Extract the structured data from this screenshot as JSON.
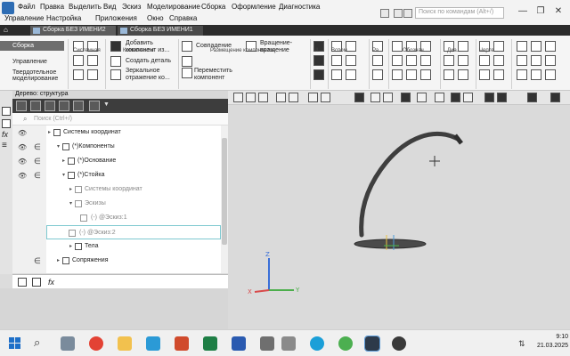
{
  "menu": {
    "items": [
      "Файл",
      "Правка",
      "Выделить",
      "Вид",
      "Эскиз",
      "Моделирование",
      "Сборка",
      "Оформление",
      "Диагностика"
    ],
    "items2": [
      "Управление",
      "Настройка",
      "Приложения",
      "Окно",
      "Справка"
    ],
    "search_placeholder": "Поиск по командам (Alt+/)"
  },
  "doc_tabs": [
    "Сборка БЕЗ ИМЕНИ2",
    "Сборка БЕЗ ИМЕНИ1"
  ],
  "left_tabs": [
    "Сборка",
    "Управление",
    "Твердотельное",
    "моделирование"
  ],
  "ribbon": {
    "add_component_1": "Добавить",
    "add_component_2": "компонент из...",
    "create_part": "Создать деталь",
    "mirror_1": "Зеркальное",
    "mirror_2": "отражение ко...",
    "match": "Совпадение",
    "rotate_1": "Вращение-",
    "rotate_2": "вращение",
    "move_1": "Переместить",
    "move_2": "компонент",
    "groups": [
      "Системная",
      "Компоненты",
      "Размещение компонентов",
      "М...",
      "Вспом...",
      "Ра...",
      "Обознач...",
      "Диа...",
      "Черте..."
    ]
  },
  "tree": {
    "header": "Дерево: структура",
    "search_placeholder": "Поиск (Ctrl+/)",
    "rows": [
      {
        "label": "Системы координат",
        "grey": false
      },
      {
        "label": "(*)Компоненты",
        "grey": false
      },
      {
        "label": "(*)Основание",
        "grey": false
      },
      {
        "label": "(*)Стойка",
        "grey": false
      },
      {
        "label": "Системы координат",
        "grey": true
      },
      {
        "label": "Эскизы",
        "grey": true
      },
      {
        "label": "(-) @Эскиз:1",
        "grey": true
      },
      {
        "label": "(-) @Эскиз:2",
        "grey": true
      },
      {
        "label": "Тела",
        "grey": false
      },
      {
        "label": "Сопряжения",
        "grey": false
      }
    ]
  },
  "clock": {
    "time": "9:10",
    "date": "21.03.2025"
  },
  "colors": {
    "accent": "#2e6db4",
    "tree_selection": "#7ec9d0"
  }
}
